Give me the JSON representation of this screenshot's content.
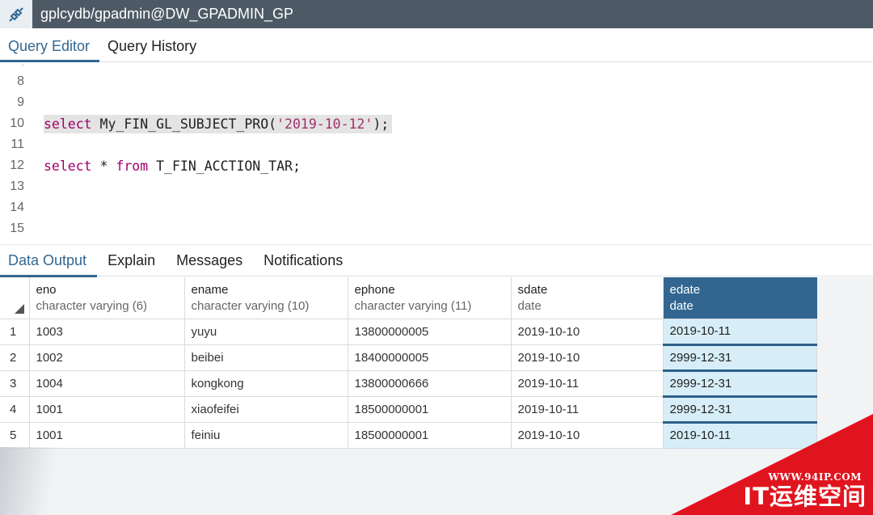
{
  "titlebar": {
    "title": "gplcydb/gpadmin@DW_GPADMIN_GP",
    "icon": "database-connection-icon"
  },
  "editor_tabs": [
    {
      "label": "Query Editor",
      "active": true
    },
    {
      "label": "Query History",
      "active": false
    }
  ],
  "editor": {
    "lines": [
      {
        "num": "8",
        "code": ""
      },
      {
        "num": "9",
        "code": ""
      },
      {
        "num": "10",
        "kw": "select",
        "rest_pre": " My_FIN_GL_SUBJECT_PRO(",
        "string": "'2019-10-12'",
        "rest_post": ");"
      },
      {
        "num": "11",
        "code": ""
      },
      {
        "num": "12",
        "kw": "select",
        "mid": " * ",
        "kw2": "from",
        "rest": " T_FIN_ACCTION_TAR;"
      },
      {
        "num": "13",
        "code": ""
      },
      {
        "num": "14",
        "code": ""
      },
      {
        "num": "15",
        "code": ""
      }
    ]
  },
  "output_tabs": [
    {
      "label": "Data Output",
      "active": true
    },
    {
      "label": "Explain",
      "active": false
    },
    {
      "label": "Messages",
      "active": false
    },
    {
      "label": "Notifications",
      "active": false
    }
  ],
  "grid": {
    "columns": [
      {
        "name": "eno",
        "type": "character varying (6)"
      },
      {
        "name": "ename",
        "type": "character varying (10)"
      },
      {
        "name": "ephone",
        "type": "character varying (11)"
      },
      {
        "name": "sdate",
        "type": "date"
      },
      {
        "name": "edate",
        "type": "date"
      }
    ],
    "rows": [
      {
        "n": "1",
        "cells": [
          "1003",
          "yuyu",
          "13800000005",
          "2019-10-10",
          "2019-10-11"
        ]
      },
      {
        "n": "2",
        "cells": [
          "1002",
          "beibei",
          "18400000005",
          "2019-10-10",
          "2999-12-31"
        ]
      },
      {
        "n": "3",
        "cells": [
          "1004",
          "kongkong",
          "13800000666",
          "2019-10-11",
          "2999-12-31"
        ]
      },
      {
        "n": "4",
        "cells": [
          "1001",
          "xiaofeifei",
          "18500000001",
          "2019-10-11",
          "2999-12-31"
        ]
      },
      {
        "n": "5",
        "cells": [
          "1001",
          "feiniu",
          "18500000001",
          "2019-10-10",
          "2019-10-11"
        ]
      }
    ],
    "selected_column": "edate"
  },
  "watermark": {
    "url": "WWW.94IP.COM",
    "text": "IT运维空间"
  },
  "colors": {
    "accent": "#326690",
    "titlebar": "#4d5a66",
    "keyword": "#a0006b",
    "watermark_red": "#e0141e"
  }
}
